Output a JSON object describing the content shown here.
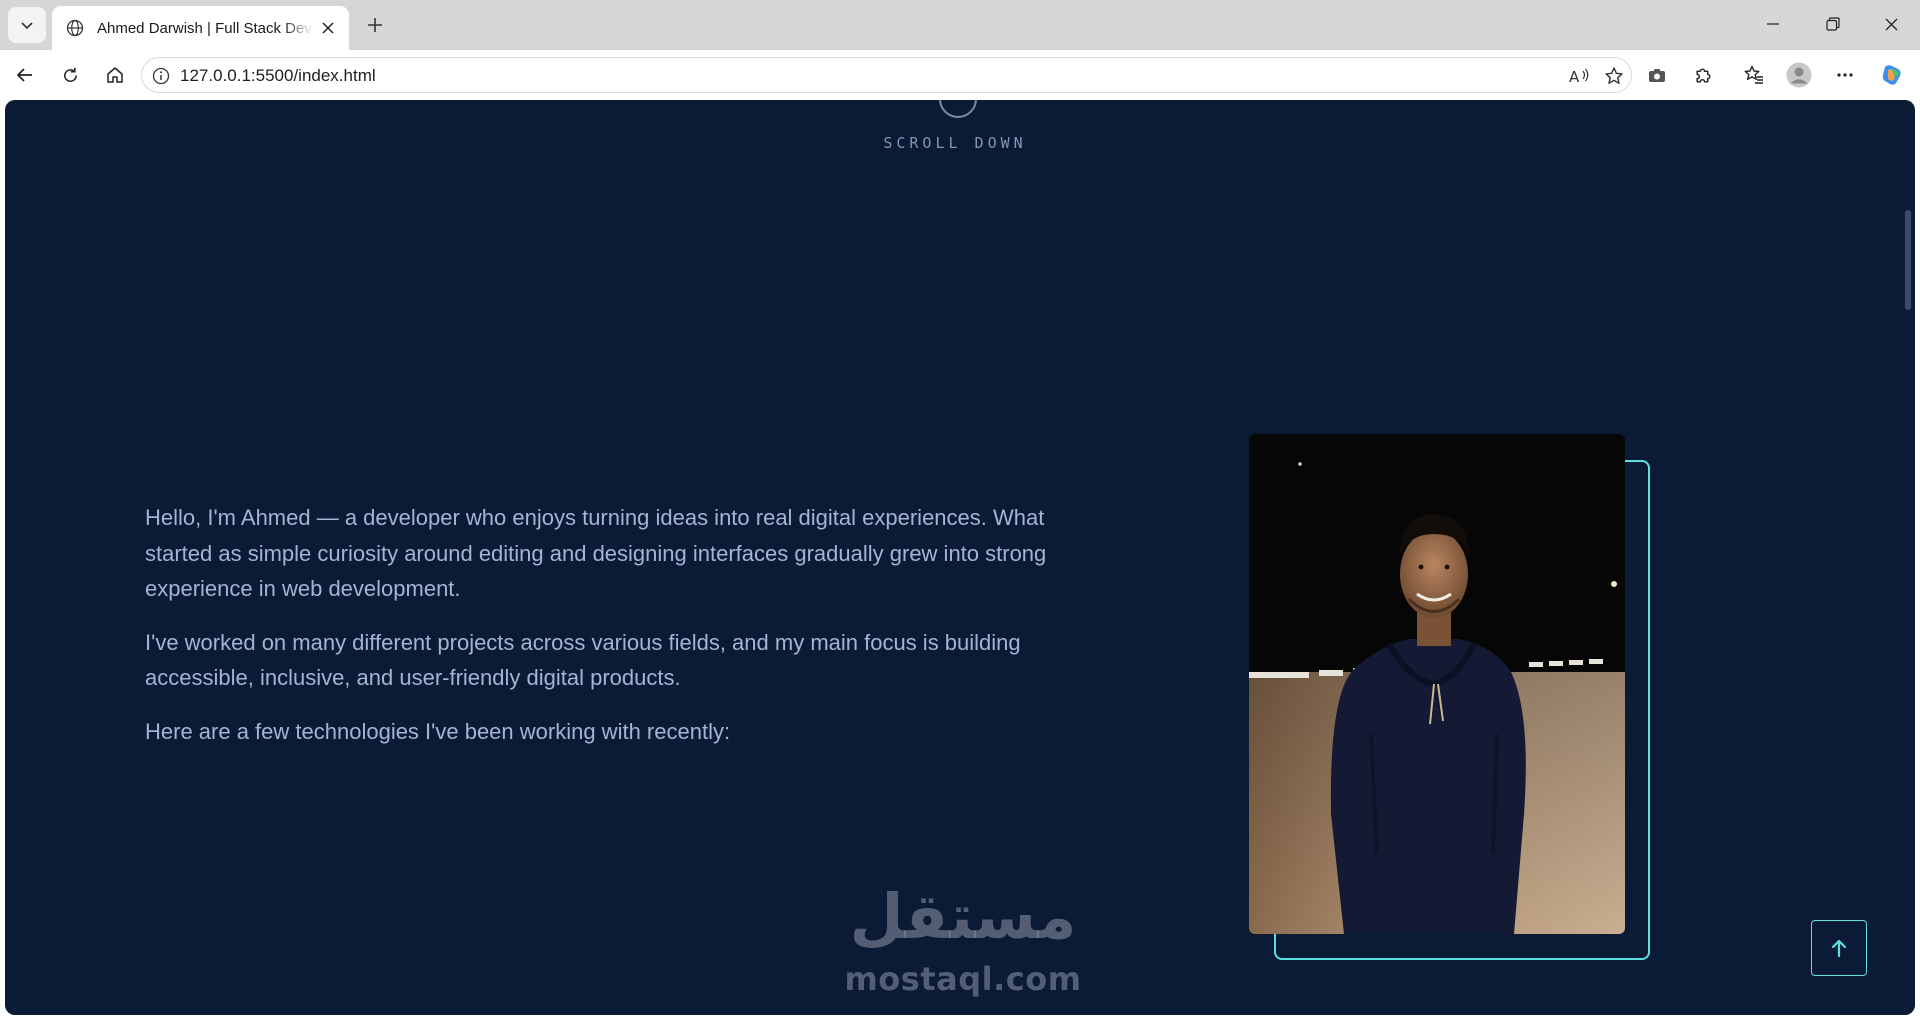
{
  "browser": {
    "tab": {
      "title": "Ahmed Darwish | Full Stack Developer"
    },
    "omnibox": {
      "url": "127.0.0.1:5500/index.html"
    },
    "icons": {
      "tab_list": "chevron-down-icon",
      "tab_favicon": "globe-icon",
      "tab_close": "close-icon",
      "new_tab": "plus-icon",
      "back": "arrow-left-icon",
      "reload": "reload-icon",
      "home": "home-icon",
      "site_info": "info-icon",
      "read_aloud": "read-aloud-icon",
      "favorite": "star-icon",
      "screenshot": "camera-icon",
      "extensions": "puzzle-icon",
      "favorites_list": "favorites-icon",
      "profile": "profile-icon",
      "more": "more-icon",
      "copilot": "copilot-icon",
      "minimize": "minimize-icon",
      "restore": "restore-icon",
      "close_window": "close-icon"
    }
  },
  "page": {
    "scroll_hint": "SCROLL DOWN",
    "about": {
      "paragraphs": [
        "Hello, I'm Ahmed — a developer who enjoys turning ideas into real digital experiences. What started as simple curiosity around editing and designing interfaces gradually grew into strong experience in web development.",
        "I've worked on many different projects across various fields, and my main focus is building accessible, inclusive, and user-friendly digital products.",
        "Here are a few technologies I've been working with recently:"
      ]
    },
    "watermark": {
      "arabic": "مستقل",
      "latin": "mostaql.com"
    },
    "back_to_top": "arrow-up-icon",
    "colors": {
      "background": "#0b1a35",
      "text": "#a8b2d1",
      "accent": "#5ee0de",
      "scroll_hint": "#8892b0"
    }
  }
}
